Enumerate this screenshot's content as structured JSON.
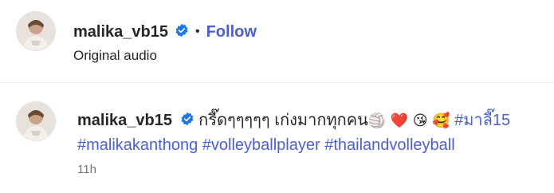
{
  "header": {
    "username": "malika_vb15",
    "separator": "•",
    "follow_label": "Follow",
    "audio_label": "Original audio"
  },
  "comment": {
    "username": "malika_vb15",
    "text": "กรี๊ดๆๆๆๆๆ เก่งมากทุกคน",
    "emojis": [
      "🏐",
      "❤️",
      "😘",
      "🥰"
    ],
    "hashtags": [
      "#มาลี๊15",
      "#malikakanthong",
      "#volleyballplayer",
      "#thailandvolleyball"
    ],
    "timestamp": "11h"
  },
  "colors": {
    "link": "#4a5fd3",
    "verified": "#1877f2",
    "muted": "#737373",
    "text": "#262626"
  },
  "icons": {
    "verified": "verified-badge-icon",
    "avatar": "profile-photo"
  }
}
